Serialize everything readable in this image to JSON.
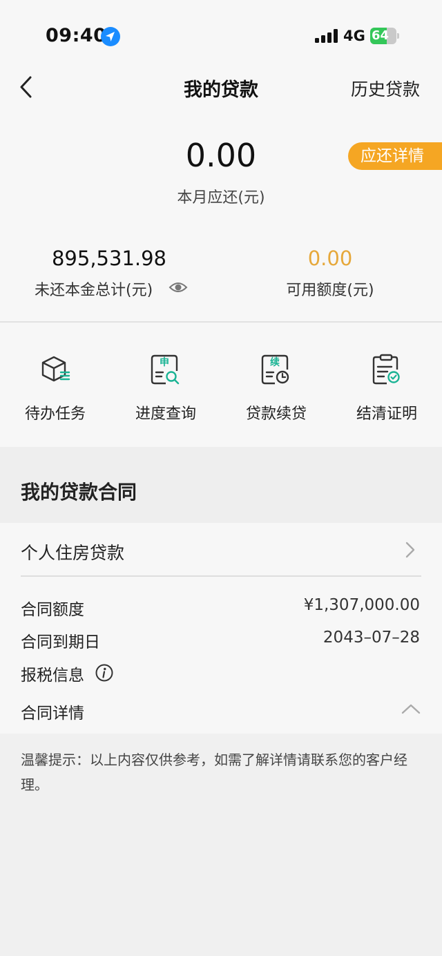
{
  "status_bar": {
    "time": "09:40",
    "network": "4G",
    "battery": "64",
    "battery_level": 0.64,
    "location_icon": "location-arrow-icon",
    "signal_icon": "signal-bars-icon"
  },
  "nav": {
    "back_icon": "chevron-left-icon",
    "title": "我的贷款",
    "history_label": "历史贷款"
  },
  "summary": {
    "due_amount": "0.00",
    "due_label": "本月应还(元)",
    "due_detail_button": "应还详情",
    "principal_value": "895,531.98",
    "principal_label": "未还本金总计(元)",
    "credit_value": "0.00",
    "credit_label": "可用额度(元)"
  },
  "quick_actions": [
    {
      "label": "待办任务",
      "icon": "task-box-icon"
    },
    {
      "label": "进度查询",
      "icon": "application-search-icon",
      "glyph": "申"
    },
    {
      "label": "贷款续贷",
      "icon": "renewal-clock-icon",
      "glyph": "续"
    },
    {
      "label": "结清证明",
      "icon": "clipboard-check-icon"
    }
  ],
  "contracts": {
    "section_title": "我的贷款合同",
    "loan_type": "个人住房贷款",
    "rows": [
      {
        "label": "合同额度",
        "value": "¥1,307,000.00"
      },
      {
        "label": "合同到期日",
        "value": "2043–07–28"
      }
    ],
    "tax_info_label": "报税信息",
    "detail_label": "合同详情"
  },
  "notice": {
    "text": "温馨提示：以上内容仅供参考，如需了解详情请联系您的客户经理。"
  },
  "colors": {
    "accent_orange": "#f5a623",
    "credit_gold": "#e6a83b",
    "icon_green": "#1ab394",
    "battery_green": "#34c759",
    "location_blue": "#1a8cff"
  }
}
